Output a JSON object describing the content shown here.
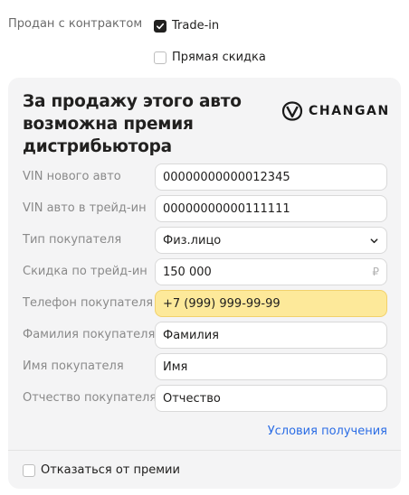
{
  "contract": {
    "label": "Продан с контрактом",
    "trade_in": {
      "label": "Trade-in",
      "checked": true
    },
    "direct_discount": {
      "label": "Прямая скидка",
      "checked": false
    }
  },
  "promo": {
    "title": "За продажу этого авто возможна премия дистрибьютора",
    "brand": "CHANGAN"
  },
  "form": {
    "vin_new": {
      "label": "VIN нового авто",
      "value": "00000000000012345"
    },
    "vin_trade": {
      "label": "VIN авто в трейд-ин",
      "value": "00000000000111111"
    },
    "buyer_type": {
      "label": "Тип покупателя",
      "value": "Физ.лицо"
    },
    "trade_discount": {
      "label": "Скидка по трейд-ин",
      "value": "150 000",
      "suffix": "₽"
    },
    "phone": {
      "label": "Телефон покупателя",
      "value": "+7 (999) 999-99-99"
    },
    "last_name": {
      "label": "Фамилия покупателя",
      "value": "Фамилия"
    },
    "first_name": {
      "label": "Имя покупателя",
      "value": "Имя"
    },
    "middle_name": {
      "label": "Отчество покупателя",
      "value": "Отчество"
    }
  },
  "conditions_link": "Условия получения",
  "decline": {
    "label": "Отказаться от премии",
    "checked": false
  }
}
